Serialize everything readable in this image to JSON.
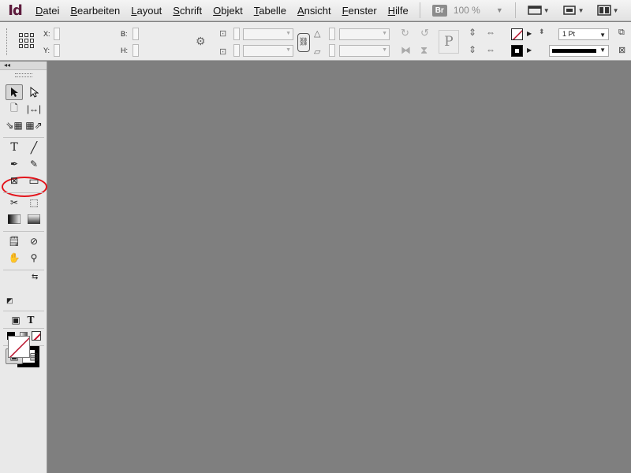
{
  "app": {
    "logo": "Id"
  },
  "menu": [
    "Datei",
    "Bearbeiten",
    "Layout",
    "Schrift",
    "Objekt",
    "Tabelle",
    "Ansicht",
    "Fenster",
    "Hilfe"
  ],
  "menubar_right": {
    "bridge_label": "Br",
    "zoom": "100 %"
  },
  "control_panel": {
    "x_label": "X:",
    "y_label": "Y:",
    "w_label": "B:",
    "h_label": "H:",
    "stroke_weight": "1 Pt",
    "paragraph_icon": "P"
  },
  "toolbox": {
    "collapse_label": "◂◂"
  },
  "colors": {
    "highlight_ring": "#e3141b",
    "canvas": "#7f7f7f",
    "panel": "#ececec"
  }
}
